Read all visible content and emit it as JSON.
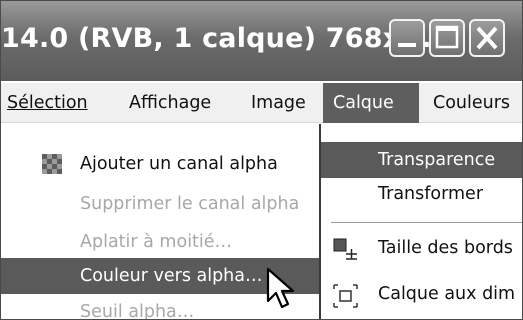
{
  "window": {
    "title": "14.0 (RVB, 1 calque) 768x...",
    "buttons": {
      "minimize": "minimize",
      "maximize": "maximize",
      "close": "close"
    }
  },
  "menubar": {
    "items": [
      {
        "label": "Sélection",
        "mnemonic": "S"
      },
      {
        "label": "Affichage",
        "mnemonic": "A"
      },
      {
        "label": "Image",
        "mnemonic": "I"
      },
      {
        "label": "Calque",
        "mnemonic": "C",
        "active": true
      },
      {
        "label": "Couleurs",
        "mnemonic": "u"
      }
    ]
  },
  "left_menu": {
    "items": [
      {
        "label": "Ajouter un canal alpha",
        "state": "enabled",
        "icon": "alpha-checker-icon"
      },
      {
        "label": "Supprimer le canal alpha",
        "state": "disabled"
      },
      {
        "label": "Aplatir à moitié…",
        "state": "disabled"
      },
      {
        "label": "Couleur vers alpha…",
        "state": "highlighted"
      },
      {
        "label": "Seuil alpha…",
        "state": "disabled"
      }
    ]
  },
  "right_menu": {
    "items": [
      {
        "label": "Transparence",
        "state": "highlighted"
      },
      {
        "label": "Transformer",
        "state": "enabled"
      },
      {
        "label": "Taille des bords",
        "state": "enabled",
        "icon": "layer-boundary-size-icon"
      },
      {
        "label": "Calque aux dim",
        "state": "enabled",
        "icon": "layer-to-image-size-icon"
      }
    ]
  },
  "colors": {
    "menu_highlight": "#5a5a5a",
    "disabled_text": "#a8a8a8",
    "titlebar": "#707070"
  }
}
